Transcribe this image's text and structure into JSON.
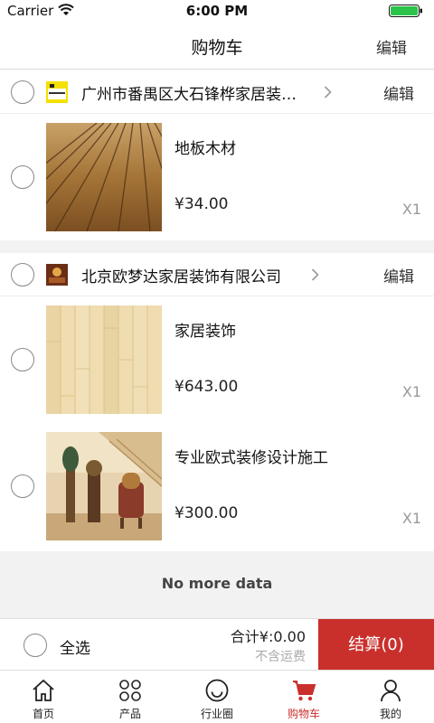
{
  "status_bar": {
    "carrier": "Carrier",
    "time": "6:00 PM"
  },
  "nav": {
    "title": "购物车",
    "edit_label": "编辑"
  },
  "shops": [
    {
      "name": "广州市番禺区大石锋桦家居装…",
      "edit_label": "编辑",
      "items": [
        {
          "title": "地板木材",
          "price": "¥34.00",
          "qty": "X1"
        }
      ]
    },
    {
      "name": "北京欧梦达家居装饰有限公司",
      "edit_label": "编辑",
      "items": [
        {
          "title": "家居装饰",
          "price": "¥643.00",
          "qty": "X1"
        },
        {
          "title": "专业欧式装修设计施工",
          "price": "¥300.00",
          "qty": "X1"
        }
      ]
    }
  ],
  "footer_note": "No more data",
  "bottom_bar": {
    "select_all_label": "全选",
    "total_label": "合计¥:0.00",
    "shipping_note": "不含运费",
    "checkout_label": "结算(0)"
  },
  "tabbar": {
    "items": [
      {
        "label": "首页",
        "icon": "home-icon"
      },
      {
        "label": "产品",
        "icon": "grid-icon"
      },
      {
        "label": "行业圈",
        "icon": "smile-icon"
      },
      {
        "label": "购物车",
        "icon": "cart-icon",
        "active": true
      },
      {
        "label": "我的",
        "icon": "user-icon"
      }
    ]
  },
  "colors": {
    "accent": "#c9302c",
    "background": "#f2f2f2"
  }
}
